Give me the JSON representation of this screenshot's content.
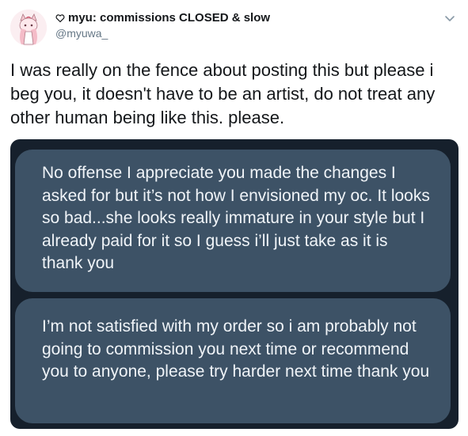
{
  "header": {
    "display_name": "myu: commissions CLOSED & slow",
    "handle": "@myuwa_"
  },
  "tweet": {
    "text": "I was really on the fence about posting this but please i beg you, it doesn't have to be an artist, do not treat any other human being like this. please."
  },
  "media": {
    "messages": [
      "No offense I appreciate you made the changes I asked for but it’s not how I envisioned my oc. It looks so bad...she looks really immature in your style but I already paid for it so I guess i’ll just take as it is thank you",
      "I’m not satisfied with my order so i am probably not going to commission you next time or recommend you to anyone, please try harder next time thank you"
    ]
  },
  "colors": {
    "media_background": "#16202c",
    "bubble": "#3d5266",
    "bubble_text": "#f0f4f8",
    "handle": "#657786"
  },
  "icons": [
    "avatar-image",
    "heart-icon",
    "chevron-down-icon"
  ]
}
